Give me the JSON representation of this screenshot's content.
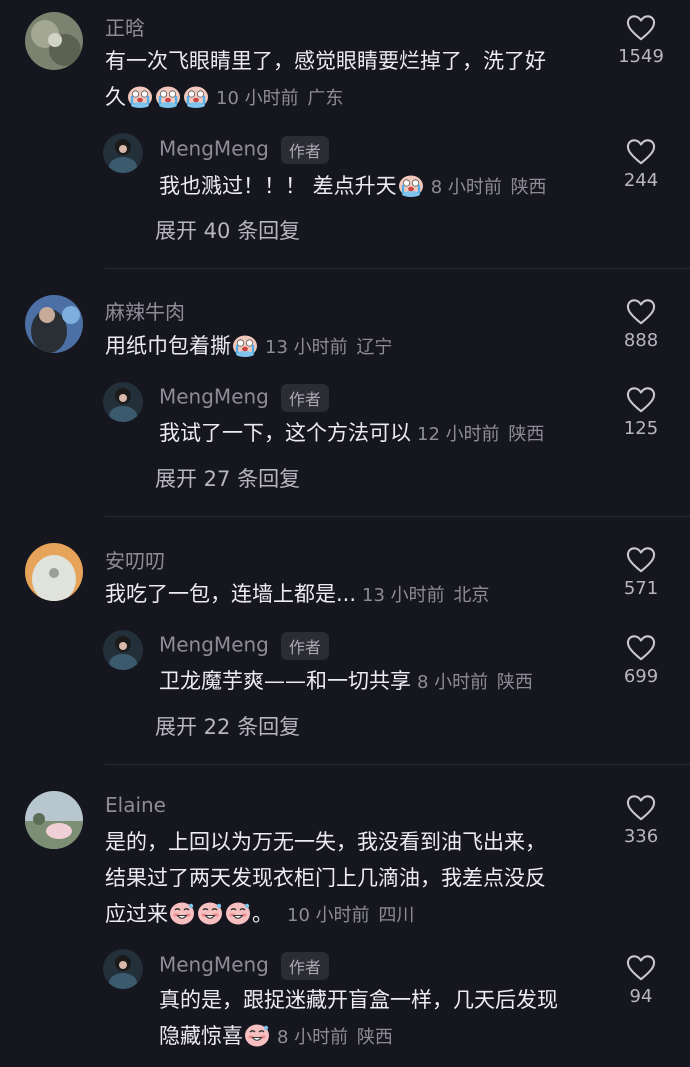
{
  "author_badge": "作者",
  "colors": {
    "background": "#16161e",
    "text": "#ecebf0",
    "muted": "#8d8c96"
  },
  "comments": [
    {
      "user": "正晗",
      "text_line1": "有一次飞眼睛里了，感觉眼睛要烂掉了，洗了好",
      "text_line2": "久",
      "time": "10 小时前",
      "location": "广东",
      "likes": "1549",
      "reply": {
        "user": "MengMeng",
        "text": "我也溅过！！！ 差点升天",
        "time": "8 小时前",
        "location": "陕西",
        "likes": "244"
      },
      "expand": "展开 40 条回复"
    },
    {
      "user": "麻辣牛肉",
      "text_line1": "用纸巾包着撕",
      "time": "13 小时前",
      "location": "辽宁",
      "likes": "888",
      "reply": {
        "user": "MengMeng",
        "text": "我试了一下，这个方法可以",
        "time": "12 小时前",
        "location": "陕西",
        "likes": "125"
      },
      "expand": "展开 27 条回复"
    },
    {
      "user": "安叨叨",
      "text_line1": "我吃了一包，连墙上都是...",
      "time": "13 小时前",
      "location": "北京",
      "likes": "571",
      "reply": {
        "user": "MengMeng",
        "text": "卫龙魔芋爽——和一切共享",
        "time": "8 小时前",
        "location": "陕西",
        "likes": "699"
      },
      "expand": "展开 22 条回复"
    },
    {
      "user": "Elaine",
      "text_line1": "是的，上回以为万无一失，我没看到油飞出来，",
      "text_line2": "结果过了两天发现衣柜门上几滴油，我差点没反",
      "text_line3": "应过来",
      "text_line3_suffix": "。",
      "time": "10 小时前",
      "location": "四川",
      "likes": "336",
      "reply": {
        "user": "MengMeng",
        "text_line1": "真的是，跟捉迷藏开盲盒一样，几天后发现",
        "text_line2": "隐藏惊喜",
        "time": "8 小时前",
        "location": "陕西",
        "likes": "94"
      }
    }
  ]
}
